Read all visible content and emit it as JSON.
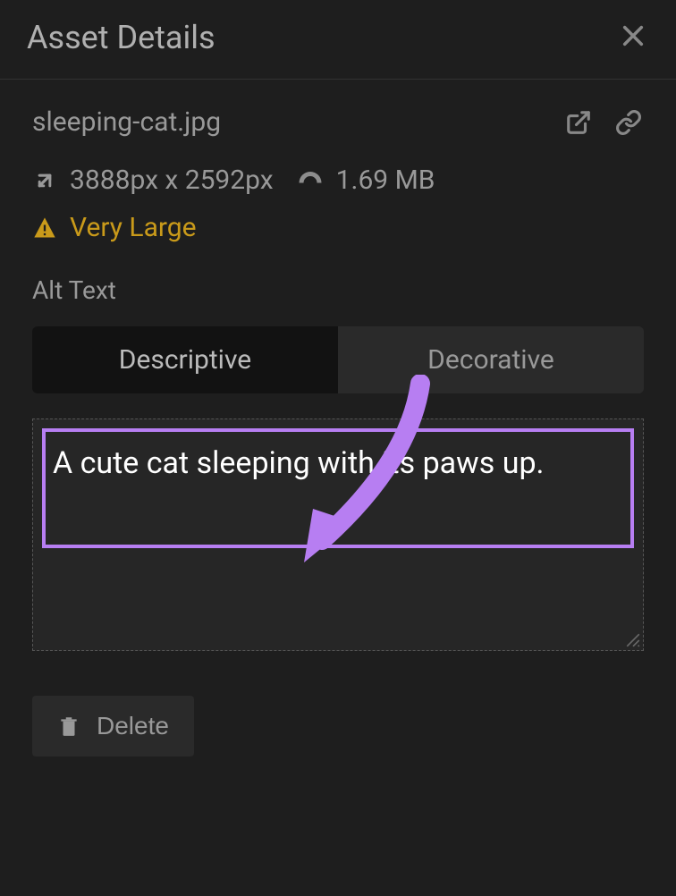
{
  "header": {
    "title": "Asset Details"
  },
  "asset": {
    "filename": "sleeping-cat.jpg",
    "dimensions": "3888px x 2592px",
    "filesize": "1.69 MB",
    "size_warning": "Very Large"
  },
  "alt_text": {
    "label": "Alt Text",
    "tabs": {
      "descriptive": "Descriptive",
      "decorative": "Decorative"
    },
    "value": "A cute cat sleeping with its paws up."
  },
  "actions": {
    "delete": "Delete"
  },
  "colors": {
    "highlight": "#b77ef2",
    "warning": "#c99a1a"
  }
}
